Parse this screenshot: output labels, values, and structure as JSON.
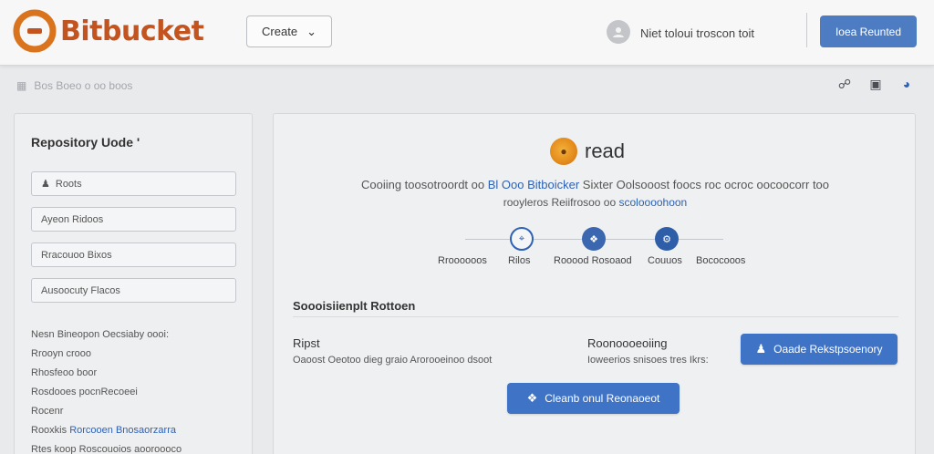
{
  "app": {
    "logo_text": "Bitbucket",
    "brand_color": "#c4541f",
    "accent_color": "#3f73c5"
  },
  "header": {
    "create_label": "Create",
    "user_name": "Niet toloui troscon toit",
    "primary_button_label": "Ioea Reunted"
  },
  "subbar": {
    "text": "Bos Boeo o oo boos"
  },
  "sidebar": {
    "title": "Repository Uode '",
    "fields": [
      {
        "label": "Roots"
      },
      {
        "label": "Ayeon Ridoos"
      },
      {
        "label": "Rracouoo Bixos"
      },
      {
        "label": "Ausoocuty Flacos"
      }
    ],
    "lines": [
      {
        "text": "Nesn Bineopon Oecsiaby oooi:"
      },
      {
        "prefix": "",
        "text": "Rrooyn crooo"
      },
      {
        "prefix": "",
        "text": "Rhosfeoo boor"
      },
      {
        "prefix": "",
        "text": "Rosdooes pocnRecoeei"
      },
      {
        "prefix": "",
        "text": "Rocenr"
      },
      {
        "prefix": "Rooxkis ",
        "link": "Rorcooen Bnosaorzarra"
      },
      {
        "prefix": "Rtes koop Roscouoios ",
        "text": "aooroooco"
      }
    ]
  },
  "main": {
    "read_title": "read",
    "desc_line1_prefix": "Cooiing toosotroordt oo ",
    "desc_line1_link": "Bl Ooo Bitboicker",
    "desc_line1_suffix": " Sixter Oolsooost foocs roc ocroc oocoocorr too",
    "desc_line2_prefix": "rooyleros Reiifrosoo oo ",
    "desc_line2_link": "scoloooohoon",
    "steps": [
      {
        "label": "Rroooooos",
        "icon": "repo-icon"
      },
      {
        "label": "Rilos",
        "icon": "files-icon"
      },
      {
        "label": "Rooood Rosoaod",
        "icon": "settings-icon"
      },
      {
        "label": "Couuos",
        "icon": ""
      },
      {
        "label": "Bococooos",
        "icon": ""
      }
    ],
    "section_title": "Soooisiienplt Rottoen",
    "col1_title": "Ripst",
    "col1_desc": "Oaoost Oeotoo dieg graio Arorooeinoo dsoot",
    "col2_title": "Roonoooeoiing",
    "col2_desc": "Ioweerios snisoes tres Ikrs:",
    "create_repo_button": "Oaade Rekstpsoenory",
    "bottom_button": "Cleanb onul Reonaoeot"
  }
}
